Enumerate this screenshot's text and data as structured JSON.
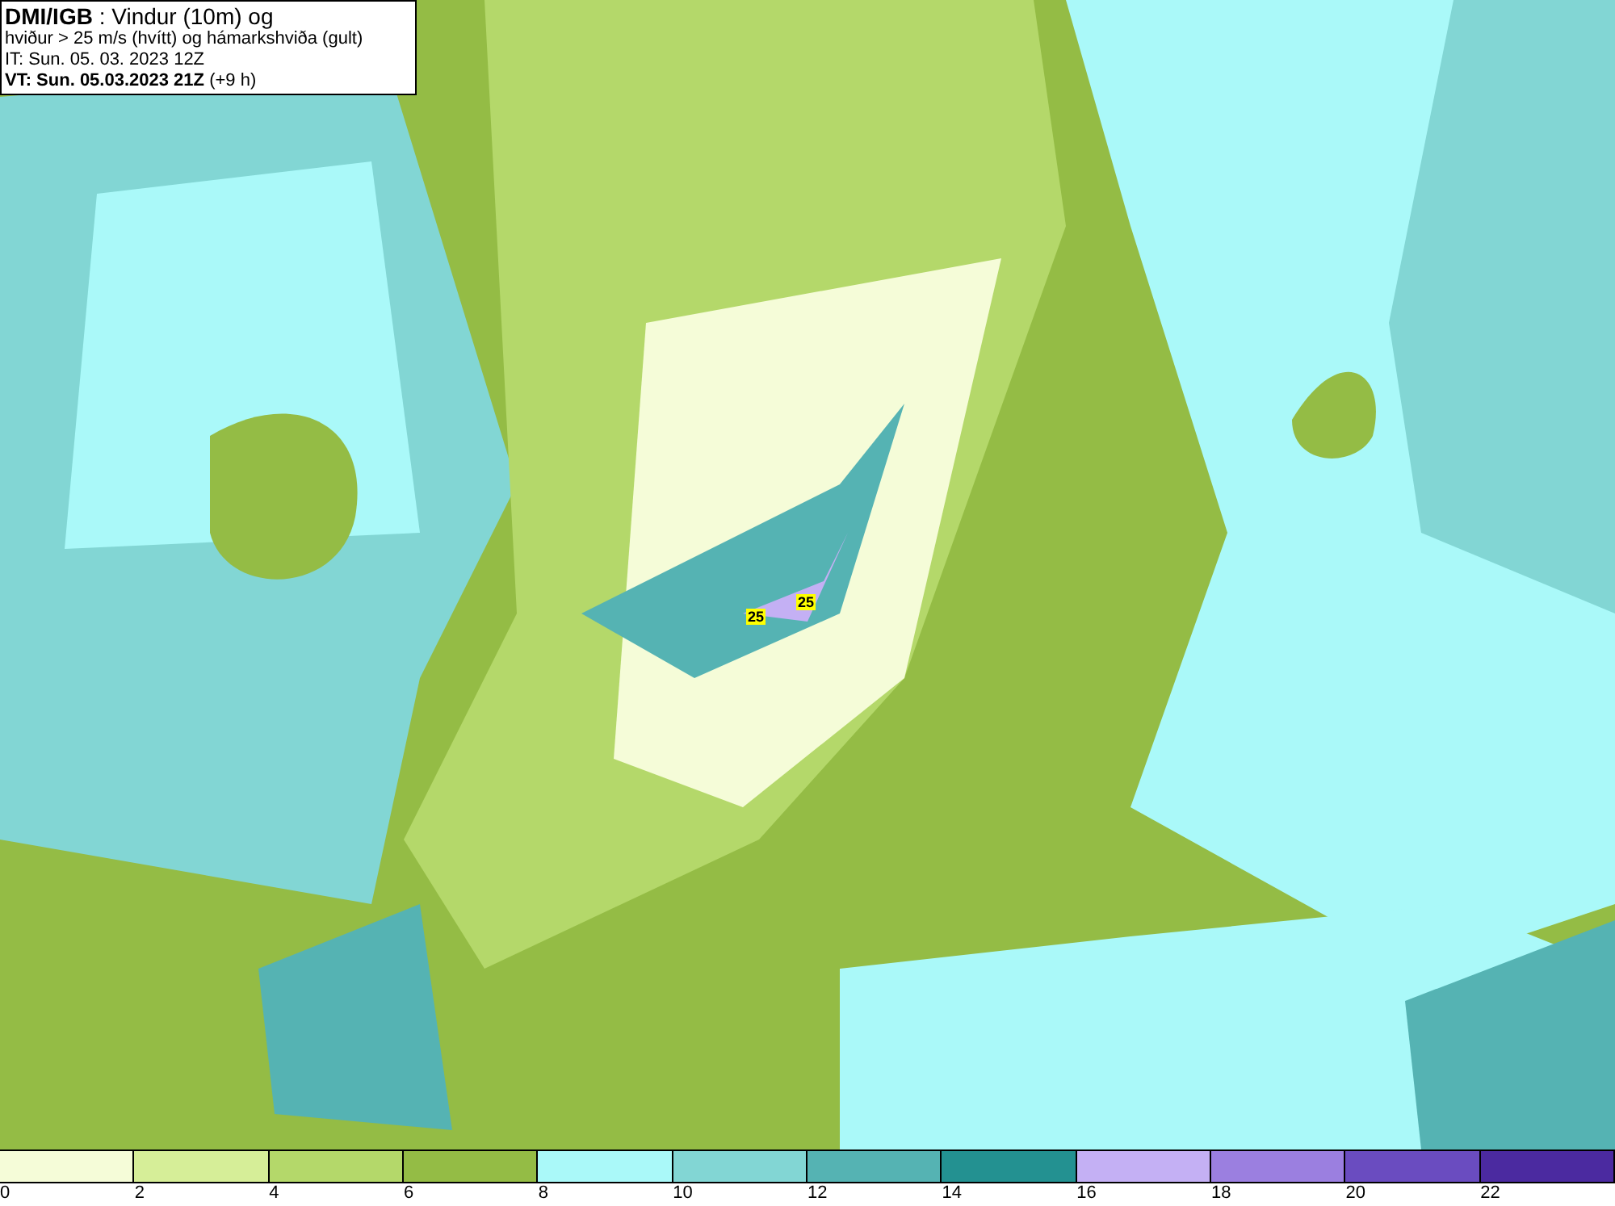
{
  "header": {
    "lines": [
      "**DMI/IGB** : Vindur (10m) og",
      "hviður > 25 m/s (hvítt) og hámarkshviða (gult)",
      "IT: Sun. 05. 03. 2023 12Z",
      "**VT: Sun. 05.03.2023 21Z** (+9 h)"
    ]
  },
  "gust_labels": [
    "25",
    "25"
  ],
  "colorbar": [
    {
      "label": "0",
      "color": "#f5fcd8"
    },
    {
      "label": "2",
      "color": "#d6ee98"
    },
    {
      "label": "4",
      "color": "#b4d86a"
    },
    {
      "label": "6",
      "color": "#94bc45"
    },
    {
      "label": "8",
      "color": "#aaf9f9"
    },
    {
      "label": "10",
      "color": "#82d6d4"
    },
    {
      "label": "12",
      "color": "#55b3b3"
    },
    {
      "label": "14",
      "color": "#239191"
    },
    {
      "label": "16",
      "color": "#c4b0f4"
    },
    {
      "label": "18",
      "color": "#9b7fe0"
    },
    {
      "label": "20",
      "color": "#6a4cc0"
    },
    {
      "label": "22",
      "color": "#4b2aa0"
    }
  ]
}
